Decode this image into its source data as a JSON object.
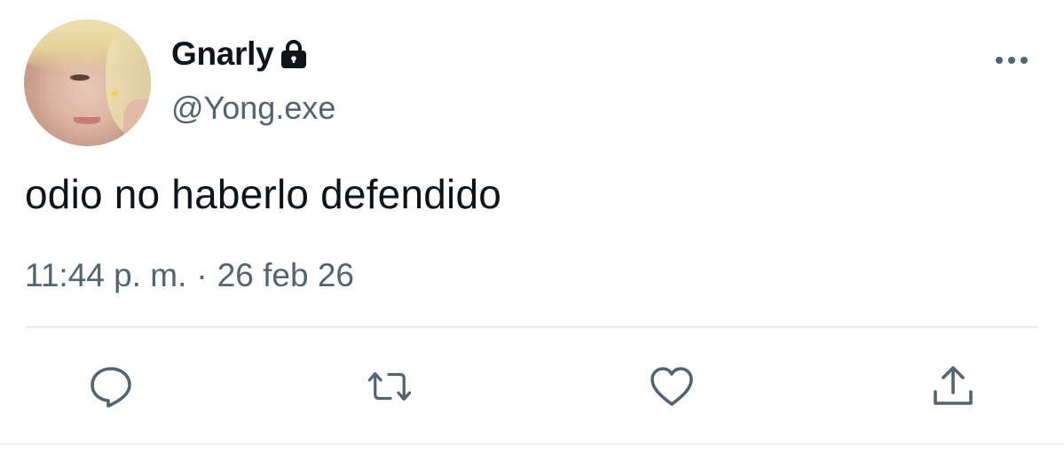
{
  "author": {
    "display_name": "Gnarly",
    "handle": "@Yong.exe",
    "protected_icon": "lock-icon"
  },
  "tweet": {
    "text": "odio no haberlo defendido",
    "time": "11:44 p. m.",
    "separator": "·",
    "date": "26 feb 26"
  },
  "header": {
    "more_icon": "more-horizontal-icon"
  },
  "actions": [
    {
      "name": "reply",
      "icon": "speech-bubble-icon"
    },
    {
      "name": "retweet",
      "icon": "retweet-icon"
    },
    {
      "name": "like",
      "icon": "heart-icon"
    },
    {
      "name": "share",
      "icon": "share-icon"
    }
  ],
  "colors": {
    "text_primary": "#0f1419",
    "text_secondary": "#536471",
    "divider": "#e6ecf0"
  }
}
